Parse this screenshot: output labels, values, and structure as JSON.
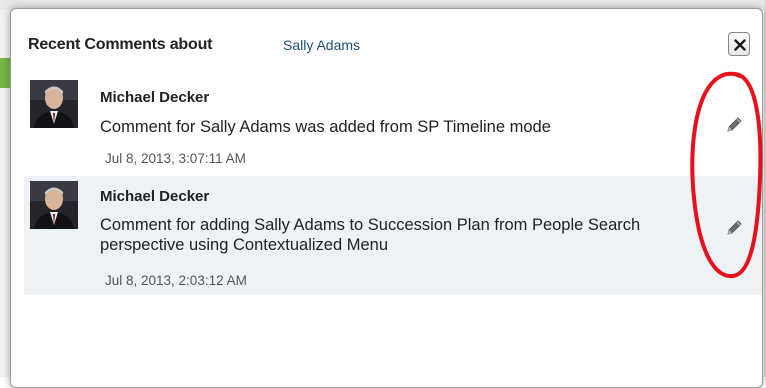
{
  "dialog": {
    "title": "Recent Comments about",
    "subject_link": "Sally Adams",
    "close_icon": "close-icon"
  },
  "comments": [
    {
      "author": "Michael Decker",
      "text": "Comment for Sally Adams was added from SP Timeline mode",
      "timestamp": "Jul 8, 2013, 3:07:11 AM",
      "edit_icon": "pencil-icon"
    },
    {
      "author": "Michael Decker",
      "text": "Comment for adding Sally Adams to Succession Plan from People Search perspective using Contextualized Menu",
      "timestamp": "Jul 8, 2013, 2:03:12 AM",
      "edit_icon": "pencil-icon"
    }
  ],
  "colors": {
    "link": "#1f4f7a",
    "row_alt_bg": "#edf2f7",
    "annotation": "#e8101a"
  }
}
